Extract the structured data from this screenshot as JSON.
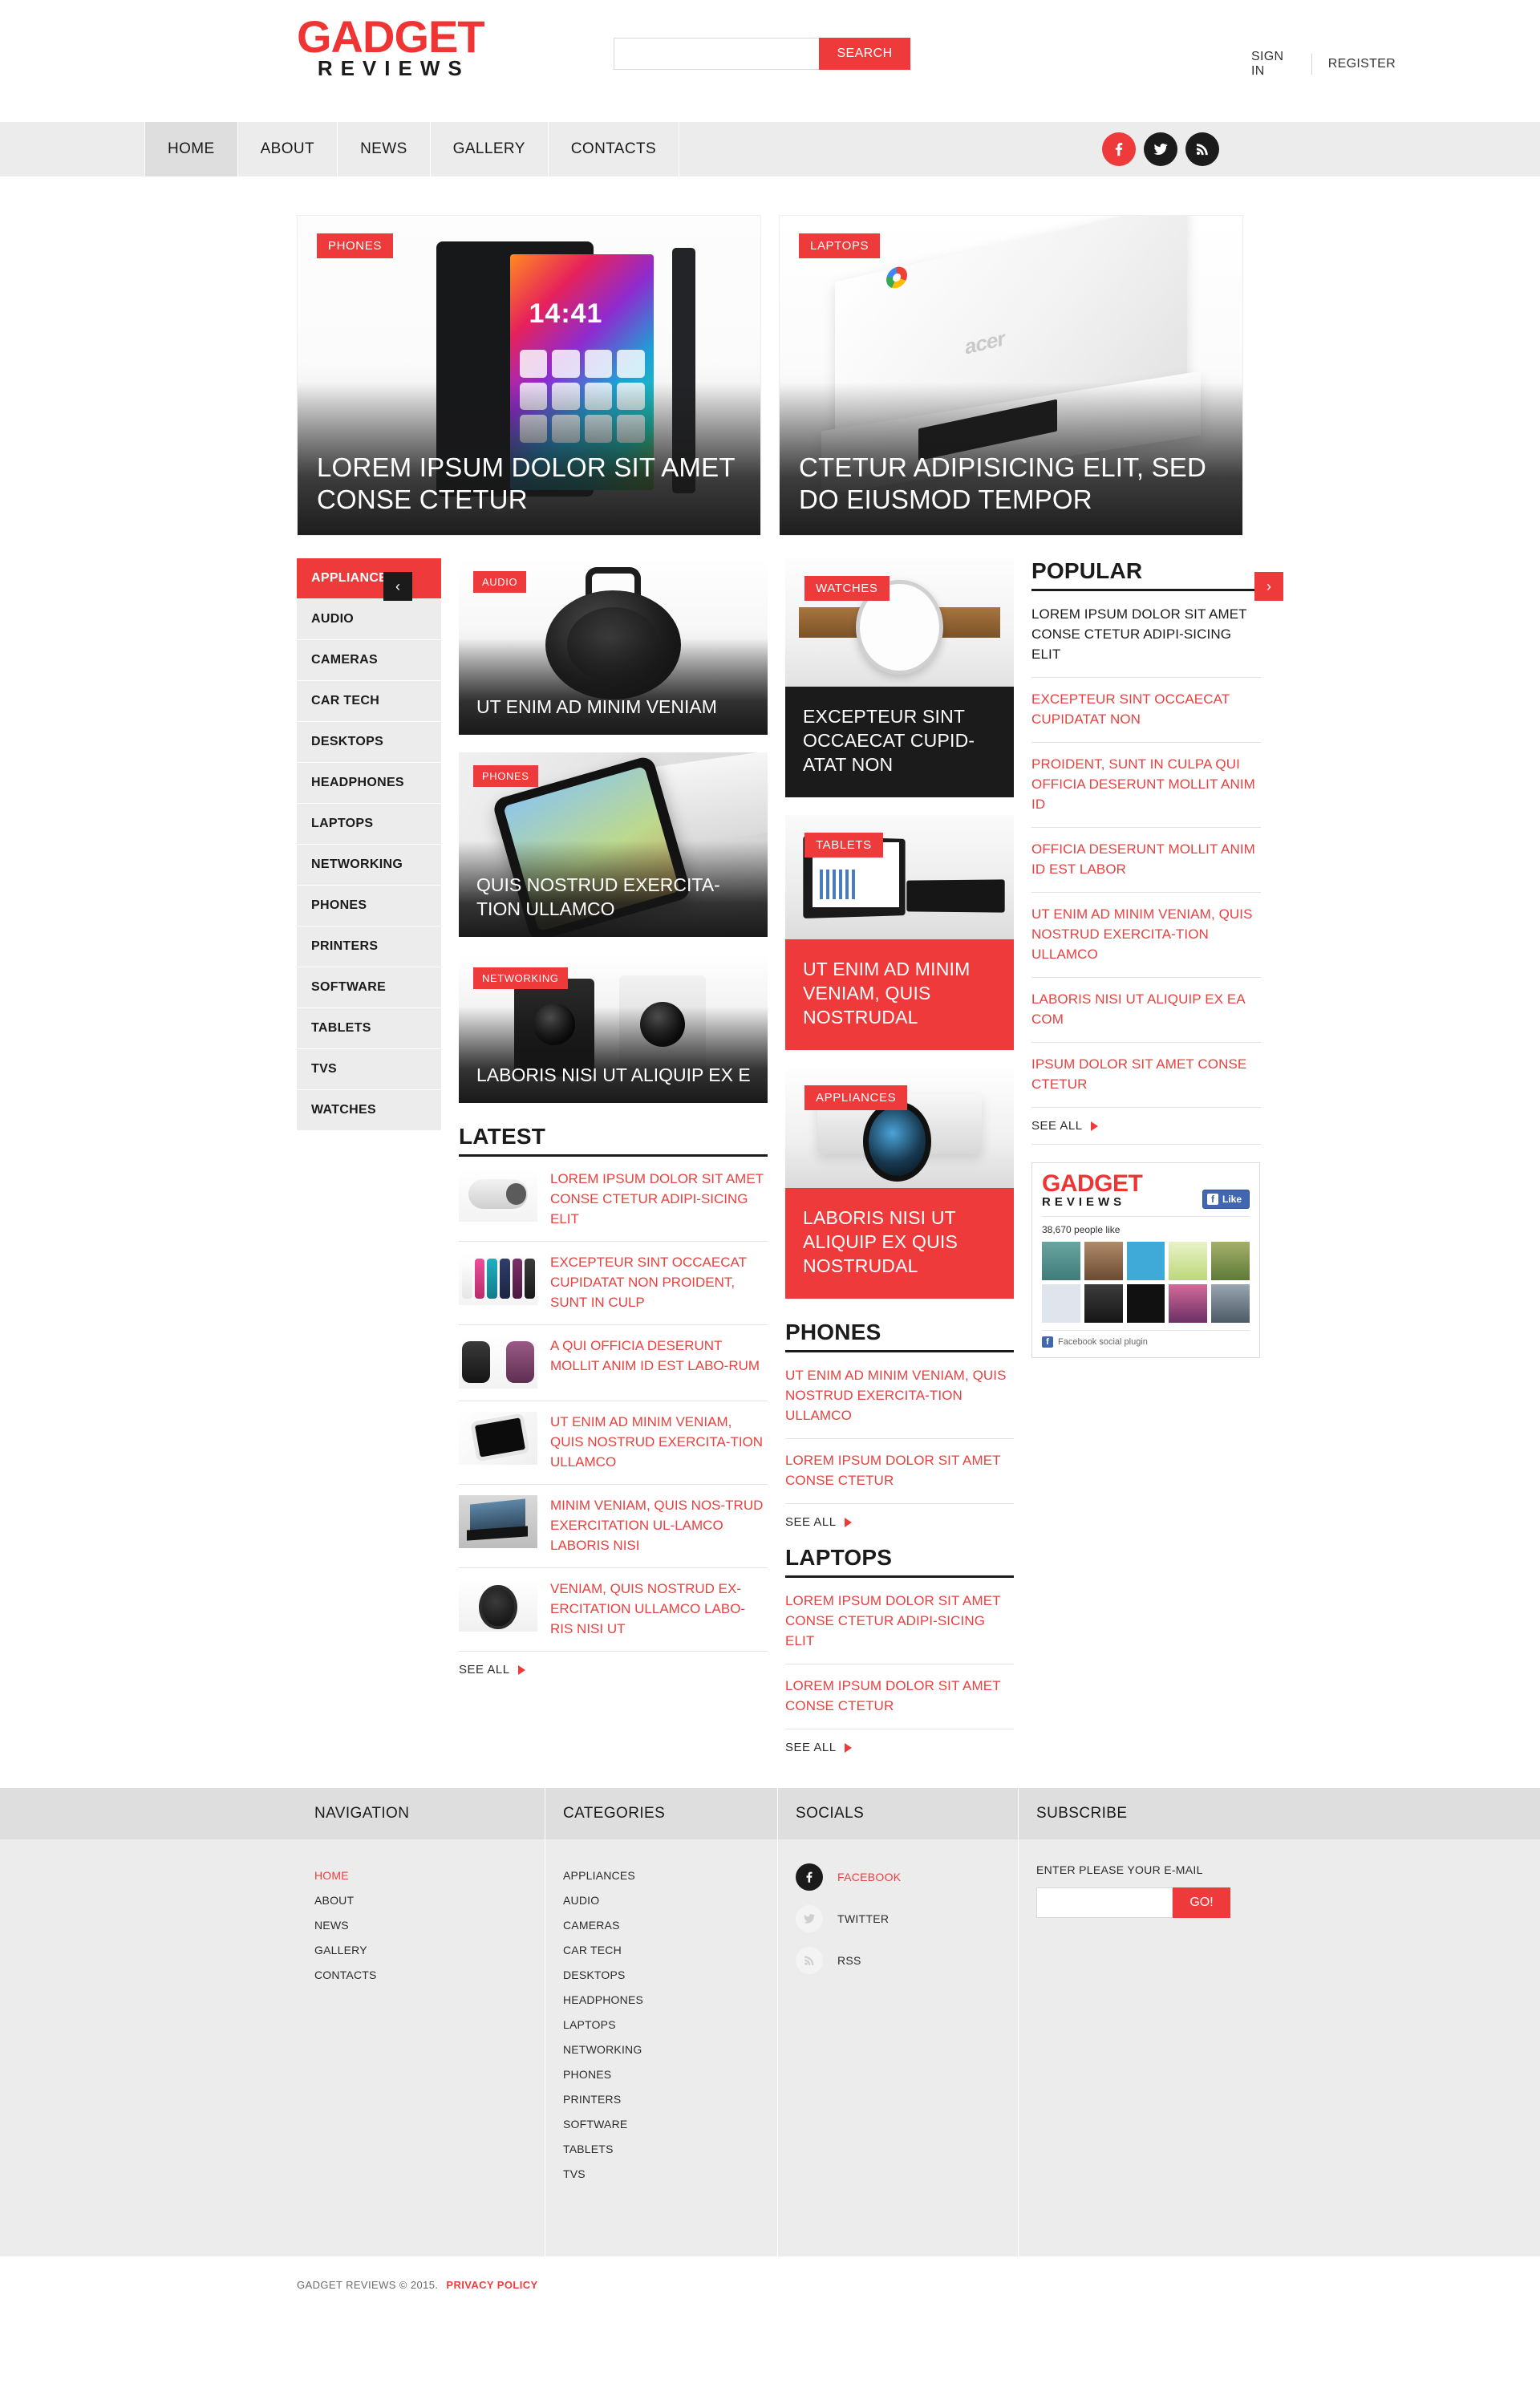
{
  "header": {
    "logo_main": "GADGET",
    "logo_sub": "REVIEWS",
    "search_placeholder": "",
    "search_value": "",
    "search_button": "SEARCH",
    "sign_in": "SIGN IN",
    "register": "REGISTER"
  },
  "nav": {
    "items": [
      {
        "label": "HOME",
        "active": true
      },
      {
        "label": "ABOUT",
        "active": false
      },
      {
        "label": "NEWS",
        "active": false
      },
      {
        "label": "GALLERY",
        "active": false
      },
      {
        "label": "CONTACTS",
        "active": false
      }
    ],
    "socials": [
      "facebook-icon",
      "twitter-icon",
      "rss-icon"
    ]
  },
  "slider": {
    "prev_label": "‹",
    "next_label": "›",
    "slides": [
      {
        "tag": "PHONES",
        "title": "LOREM IPSUM DOLOR SIT AMET CONSE CTETUR"
      },
      {
        "tag": "LAPTOPS",
        "title": "CTETUR ADIPISICING ELIT, SED DO EIUSMOD TEMPOR"
      }
    ]
  },
  "categories_sidebar": {
    "items": [
      {
        "label": "APPLIANCES",
        "active": true
      },
      {
        "label": "AUDIO",
        "active": false
      },
      {
        "label": "CAMERAS",
        "active": false
      },
      {
        "label": "CAR TECH",
        "active": false
      },
      {
        "label": "DESKTOPS",
        "active": false
      },
      {
        "label": "HEADPHONES",
        "active": false
      },
      {
        "label": "LAPTOPS",
        "active": false
      },
      {
        "label": "NETWORKING",
        "active": false
      },
      {
        "label": "PHONES",
        "active": false
      },
      {
        "label": "PRINTERS",
        "active": false
      },
      {
        "label": "SOFTWARE",
        "active": false
      },
      {
        "label": "TABLETS",
        "active": false
      },
      {
        "label": "TVS",
        "active": false
      },
      {
        "label": "WATCHES",
        "active": false
      }
    ]
  },
  "mid_cards": [
    {
      "tag": "AUDIO",
      "title": "UT ENIM AD MINIM VENIAM"
    },
    {
      "tag": "PHONES",
      "title": "QUIS NOSTRUD EXERCITA-TION ULLAMCO"
    },
    {
      "tag": "NETWORKING",
      "title": "LABORIS NISI UT ALIQUIP EX E"
    }
  ],
  "right_cards": [
    {
      "tag": "WATCHES",
      "title": "EXCEPTEUR SINT OCCAECAT CUPID-ATAT NON",
      "style": "dark"
    },
    {
      "tag": "TABLETS",
      "title": "UT ENIM AD MINIM VENIAM, QUIS NOSTRUDAL",
      "style": "red"
    },
    {
      "tag": "APPLIANCES",
      "title": "LABORIS NISI UT ALIQUIP EX QUIS NOSTRUDAL",
      "style": "red"
    }
  ],
  "popular": {
    "heading": "POPULAR",
    "items": [
      {
        "text": "LOREM IPSUM DOLOR SIT AMET CONSE CTETUR ADIPI-SICING ELIT",
        "highlight": false
      },
      {
        "text": "EXCEPTEUR SINT OCCAECAT CUPIDATAT NON",
        "highlight": true
      },
      {
        "text": "PROIDENT, SUNT IN CULPA QUI OFFICIA DESERUNT MOLLIT ANIM ID",
        "highlight": true
      },
      {
        "text": "OFFICIA DESERUNT MOLLIT ANIM ID EST LABOR",
        "highlight": true
      },
      {
        "text": "UT ENIM AD MINIM VENIAM, QUIS NOSTRUD EXERCITA-TION ULLAMCO",
        "highlight": true
      },
      {
        "text": "LABORIS NISI UT ALIQUIP EX EA COM",
        "highlight": true
      },
      {
        "text": "IPSUM DOLOR SIT AMET CONSE CTETUR",
        "highlight": true
      }
    ],
    "see_all": "SEE ALL"
  },
  "fb_widget": {
    "logo_main": "GADGET",
    "logo_sub": "REVIEWS",
    "like_button": "Like",
    "count_text": "38,670 people like",
    "plugin_text": "Facebook social plugin"
  },
  "latest": {
    "heading": "LATEST",
    "items": [
      {
        "text": "LOREM IPSUM DOLOR SIT AMET CONSE CTETUR ADIPI-SICING ELIT"
      },
      {
        "text": "EXCEPTEUR SINT OCCAECAT CUPIDATAT NON PROIDENT, SUNT IN CULP"
      },
      {
        "text": "A QUI OFFICIA DESERUNT MOLLIT ANIM ID EST LABO-RUM"
      },
      {
        "text": "UT ENIM AD MINIM VENIAM, QUIS NOSTRUD EXERCITA-TION ULLAMCO"
      },
      {
        "text": "MINIM VENIAM, QUIS NOS-TRUD EXERCITATION UL-LAMCO LABORIS NISI"
      },
      {
        "text": "VENIAM, QUIS NOSTRUD EX-ERCITATION ULLAMCO LABO-RIS NISI UT"
      }
    ],
    "see_all": "SEE ALL"
  },
  "phones_section": {
    "heading": "PHONES",
    "items": [
      {
        "text": "UT ENIM AD MINIM VENIAM, QUIS NOSTRUD EXERCITA-TION ULLAMCO"
      },
      {
        "text": "LOREM IPSUM DOLOR SIT AMET CONSE CTETUR"
      }
    ],
    "see_all": "SEE ALL"
  },
  "laptops_section": {
    "heading": "LAPTOPS",
    "items": [
      {
        "text": "LOREM IPSUM DOLOR SIT AMET CONSE CTETUR ADIPI-SICING ELIT"
      },
      {
        "text": "LOREM IPSUM DOLOR SIT AMET CONSE CTETUR"
      }
    ],
    "see_all": "SEE ALL"
  },
  "footer": {
    "navigation": {
      "title": "NAVIGATION",
      "items": [
        {
          "label": "HOME",
          "active": true
        },
        {
          "label": "ABOUT",
          "active": false
        },
        {
          "label": "NEWS",
          "active": false
        },
        {
          "label": "GALLERY",
          "active": false
        },
        {
          "label": "CONTACTS",
          "active": false
        }
      ]
    },
    "categories": {
      "title": "CATEGORIES",
      "items": [
        {
          "label": "APPLIANCES"
        },
        {
          "label": "AUDIO"
        },
        {
          "label": "CAMERAS"
        },
        {
          "label": "CAR TECH"
        },
        {
          "label": "DESKTOPS"
        },
        {
          "label": "HEADPHONES"
        },
        {
          "label": "LAPTOPS"
        },
        {
          "label": "NETWORKING"
        },
        {
          "label": "PHONES"
        },
        {
          "label": "PRINTERS"
        },
        {
          "label": "SOFTWARE"
        },
        {
          "label": "TABLETS"
        },
        {
          "label": "TVS"
        }
      ]
    },
    "socials": {
      "title": "SOCIALS",
      "items": [
        {
          "label": "FACEBOOK",
          "icon": "facebook-icon",
          "active": true
        },
        {
          "label": "TWITTER",
          "icon": "twitter-icon",
          "active": false
        },
        {
          "label": "RSS",
          "icon": "rss-icon",
          "active": false
        }
      ]
    },
    "subscribe": {
      "title": "SUBSCRIBE",
      "label": "ENTER PLEASE YOUR E-MAIL",
      "placeholder": "",
      "value": "",
      "button": "GO!"
    },
    "copyright": "GADGET REVIEWS © 2015.",
    "privacy": "PRIVACY POLICY"
  }
}
